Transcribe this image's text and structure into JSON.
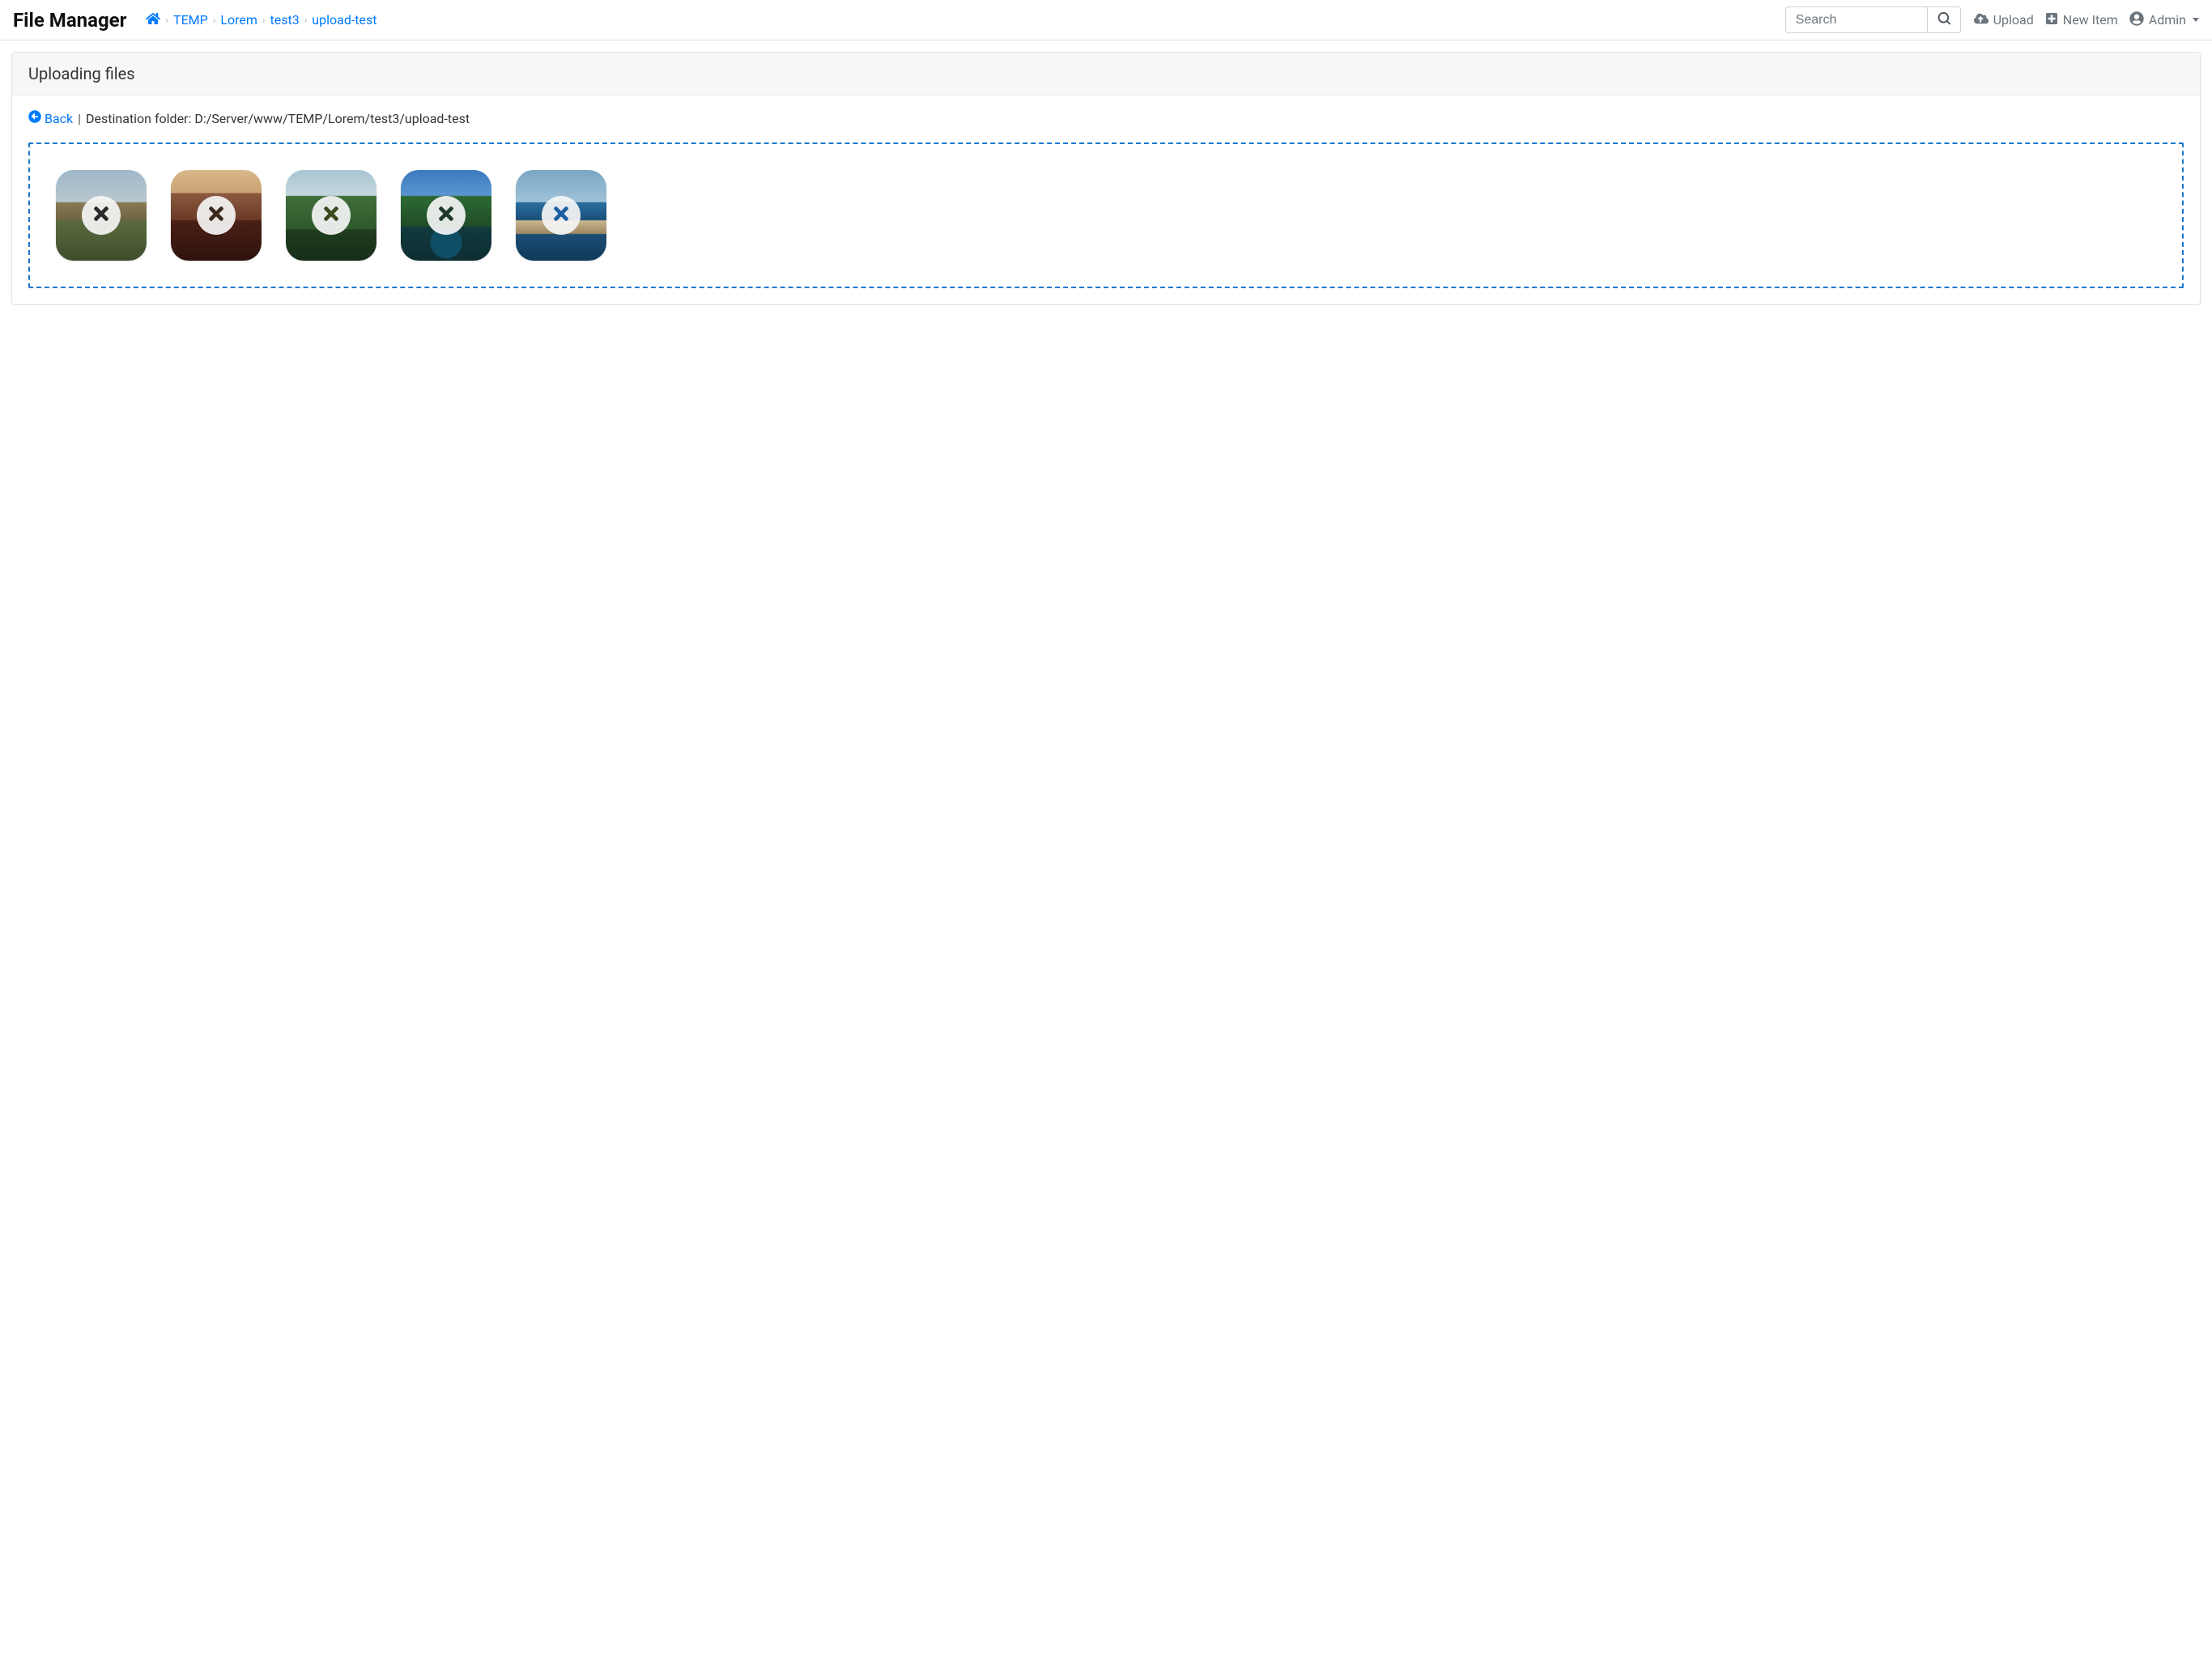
{
  "brand": "File Manager",
  "breadcrumb": {
    "items": [
      "TEMP",
      "Lorem",
      "test3",
      "upload-test"
    ]
  },
  "search": {
    "placeholder": "Search",
    "value": ""
  },
  "nav": {
    "upload_label": "Upload",
    "new_item_label": "New Item",
    "admin_label": "Admin"
  },
  "card": {
    "title": "Uploading files",
    "back_label": "Back",
    "separator": "|",
    "destination_label": "Destination folder:",
    "destination_path": "D:/Server/www/TEMP/Lorem/test3/upload-test"
  },
  "thumbnails": [
    {
      "name": "upload-thumb-1",
      "remove_icon": "close-icon"
    },
    {
      "name": "upload-thumb-2",
      "remove_icon": "close-icon"
    },
    {
      "name": "upload-thumb-3",
      "remove_icon": "close-icon"
    },
    {
      "name": "upload-thumb-4",
      "remove_icon": "close-icon"
    },
    {
      "name": "upload-thumb-5",
      "remove_icon": "close-icon"
    }
  ],
  "colors": {
    "link": "#007bff",
    "dropzone_border": "#1877d2",
    "muted": "#6c757d"
  }
}
